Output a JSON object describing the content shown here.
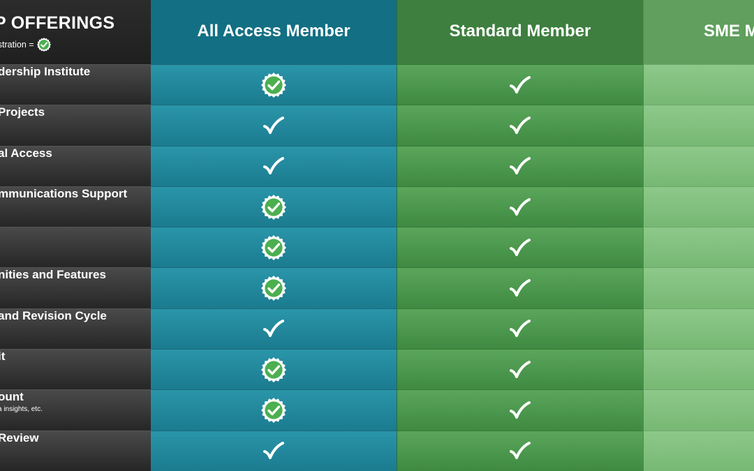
{
  "header": {
    "title": "P OFFERINGS",
    "subtitle": "istration =",
    "columns": [
      "All Access Member",
      "Standard Member",
      "SME M"
    ]
  },
  "rows": [
    {
      "label": "dership Institute",
      "note": "",
      "all_access": "badge",
      "standard": "check"
    },
    {
      "label": "Projects",
      "note": "",
      "all_access": "check",
      "standard": "check"
    },
    {
      "label": "al Access",
      "note": "",
      "all_access": "check",
      "standard": "check"
    },
    {
      "label": "mmunications Support",
      "note": "",
      "all_access": "badge",
      "standard": "check"
    },
    {
      "label": "",
      "note": "",
      "all_access": "badge",
      "standard": "check"
    },
    {
      "label": "nities and Features",
      "note": "",
      "all_access": "badge",
      "standard": "check"
    },
    {
      "label": "and Revision Cycle",
      "note": "",
      "all_access": "check",
      "standard": "check"
    },
    {
      "label": "it",
      "note": "",
      "all_access": "badge",
      "standard": "check"
    },
    {
      "label": "ount",
      "note": "a insights, etc.",
      "all_access": "badge",
      "standard": "check"
    },
    {
      "label": "Review",
      "note": "",
      "all_access": "check",
      "standard": "check"
    }
  ],
  "icons": {
    "check": "checkmark-icon",
    "badge": "verified-badge-icon"
  },
  "colors": {
    "all_access": "#1b7b8f",
    "standard": "#3f8a42",
    "sme": "#77b874",
    "label": "#2a2a2a",
    "badge_check": "#4caf50"
  }
}
